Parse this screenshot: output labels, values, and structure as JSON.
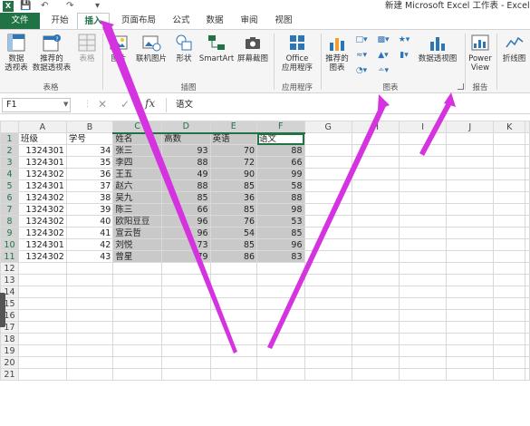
{
  "titlebar": {
    "app_logo": "X",
    "title": "新建 Microsoft Excel 工作表 - Excel",
    "qat_icons": [
      "save-icon",
      "undo-icon",
      "redo-icon",
      "customize-icon"
    ]
  },
  "tabs": [
    {
      "label": "文件"
    },
    {
      "label": "开始"
    },
    {
      "label": "插入"
    },
    {
      "label": "页面布局"
    },
    {
      "label": "公式"
    },
    {
      "label": "数据"
    },
    {
      "label": "审阅"
    },
    {
      "label": "视图"
    }
  ],
  "ribbon": {
    "table_group": {
      "label": "表格",
      "pivot_table": "数据\n透视表",
      "recommended_pivot": "推荐的\n数据透视表",
      "table": "表格"
    },
    "illustrations_group": {
      "label": "插图",
      "picture": "图片",
      "online_picture": "联机图片",
      "shapes": "形状",
      "smartart": "SmartArt",
      "screenshot": "屏幕截图"
    },
    "apps_group": {
      "label": "应用程序",
      "office_apps": "Office\n应用程序"
    },
    "charts_group": {
      "label": "图表",
      "recommended_charts": "推荐的\n图表",
      "pivot_chart": "数据透视图"
    },
    "reports_group": {
      "label": "报告",
      "power_view": "Power\nView"
    },
    "sparklines_group": {
      "line": "折线图"
    }
  },
  "formula_bar": {
    "name_box": "F1",
    "fx": "fx",
    "value": "语文"
  },
  "sheet": {
    "columns": [
      "A",
      "B",
      "C",
      "D",
      "E",
      "F",
      "G",
      "H",
      "I",
      "J",
      "K"
    ],
    "rows": [
      [
        "班级",
        "学号",
        "姓名",
        "高数",
        "英语",
        "语文"
      ],
      [
        "1324301",
        "34",
        "张三",
        "93",
        "70",
        "88"
      ],
      [
        "1324301",
        "35",
        "李四",
        "88",
        "72",
        "66"
      ],
      [
        "1324302",
        "36",
        "王五",
        "49",
        "90",
        "99"
      ],
      [
        "1324301",
        "37",
        "赵六",
        "88",
        "85",
        "58"
      ],
      [
        "1324302",
        "38",
        "吴九",
        "85",
        "36",
        "88"
      ],
      [
        "1324302",
        "39",
        "陈三",
        "66",
        "85",
        "98"
      ],
      [
        "1324302",
        "40",
        "欧阳豆豆",
        "96",
        "76",
        "53"
      ],
      [
        "1324302",
        "41",
        "宣云哲",
        "96",
        "54",
        "85"
      ],
      [
        "1324301",
        "42",
        "刘悦",
        "73",
        "85",
        "96"
      ],
      [
        "1324302",
        "43",
        "曾星",
        "79",
        "86",
        "83"
      ]
    ],
    "total_rows": 21
  },
  "colors": {
    "excel_green": "#217346",
    "selection_gray": "#c9c9c9",
    "annotation_magenta": "#d633e0"
  }
}
